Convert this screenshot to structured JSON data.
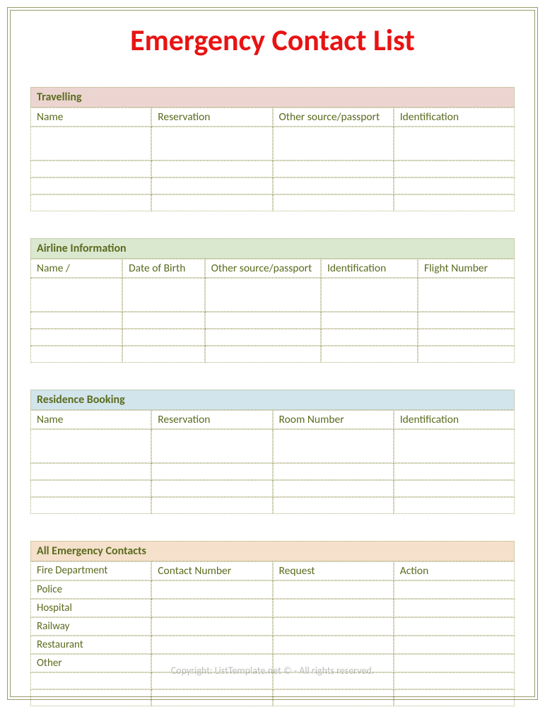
{
  "title": "Emergency Contact List",
  "sections": {
    "travelling": {
      "header": "Travelling",
      "columns": [
        "Name",
        "Reservation",
        "Other source/passport",
        "Identification"
      ]
    },
    "airline": {
      "header": "Airline Information",
      "columns": [
        "Name /",
        "Date of Birth",
        "Other source/passport",
        "Identification",
        "Flight Number"
      ]
    },
    "residence": {
      "header": "Residence Booking",
      "columns": [
        "Name",
        "Reservation",
        "Room Number",
        "Identification"
      ]
    },
    "emergency": {
      "header": "All Emergency Contacts",
      "columns": [
        "",
        "Contact Number",
        "Request",
        "Action"
      ],
      "rows": [
        "Fire Department",
        "Police",
        "Hospital",
        "Railway",
        "Restaurant",
        "Other"
      ]
    }
  },
  "copyright": "Copyright: ListTemplate.net © - All rights reserved."
}
